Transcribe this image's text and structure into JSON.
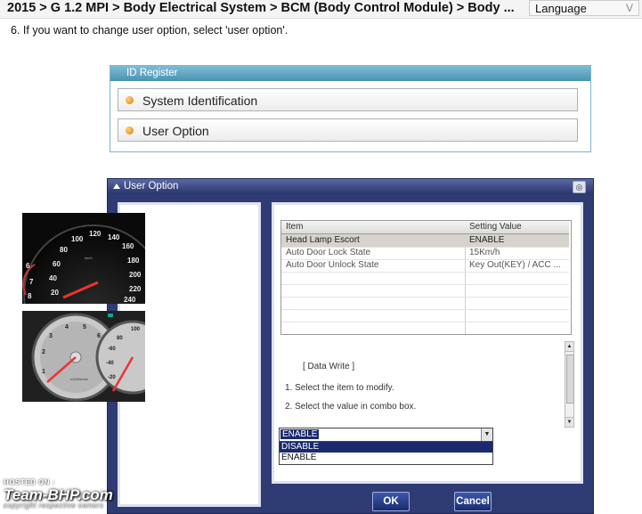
{
  "header": {
    "breadcrumb": "2015 > G 1.2 MPI > Body Electrical System > BCM (Body Control Module) > Body ...",
    "language_label": "Language",
    "language_chevron": "V"
  },
  "step_text": "6.  If you want to change user option, select 'user option'.",
  "id_register": {
    "title": "ID Register",
    "items": [
      {
        "label": "System Identification"
      },
      {
        "label": "User Option"
      }
    ]
  },
  "user_option_dialog": {
    "title": "User Option",
    "table": {
      "columns": [
        "Item",
        "Setting Value"
      ],
      "rows": [
        {
          "item": "Head Lamp Escort",
          "value": "ENABLE",
          "selected": true
        },
        {
          "item": "Auto Door Lock State",
          "value": "15Km/h",
          "selected": false
        },
        {
          "item": "Auto Door Unlock State",
          "value": "Key Out(KEY) / ACC ...",
          "selected": false
        }
      ]
    },
    "info": {
      "heading": "[ Data Write ]",
      "line1": "1. Select the item to modify.",
      "line2": "2. Select the value in combo box."
    },
    "combo": {
      "selected_value": "ENABLE",
      "options": [
        "DISABLE",
        "ENABLE"
      ],
      "highlighted_option": "DISABLE"
    },
    "ok_label": "OK",
    "cancel_label": "Cancel"
  },
  "watermark": {
    "hosted_on": "HOSTED ON :",
    "brand": "Team-BHP.com",
    "copyright": "copyright respective owners"
  },
  "colors": {
    "dialog_frame": "#2f3b73",
    "panel_header": "#4a93b2",
    "selection": "#1b2a6e",
    "bullet": "#e07b00"
  }
}
